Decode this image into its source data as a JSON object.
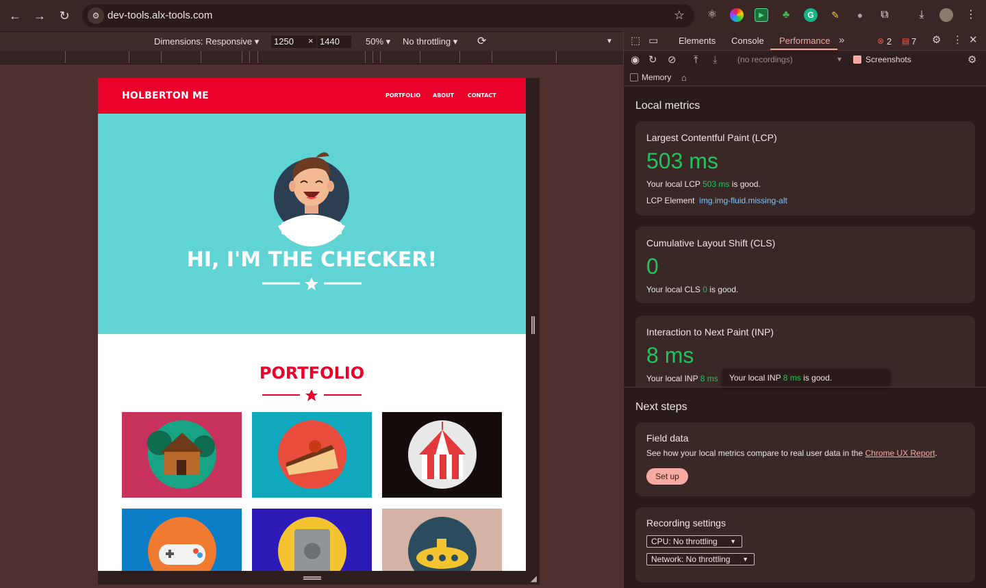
{
  "browser": {
    "url": "dev-tools.alx-tools.com"
  },
  "device_toolbar": {
    "dimensions_label": "Dimensions: Responsive",
    "width": "1250",
    "times": "×",
    "height": "1440",
    "zoom": "50%",
    "throttling": "No throttling"
  },
  "site": {
    "brand": "HOLBERTON ME",
    "nav": [
      "PORTFOLIO",
      "ABOUT",
      "CONTACT"
    ],
    "hero_title": "HI, I'M THE CHECKER!",
    "portfolio_title": "PORTFOLIO",
    "colors": {
      "red": "#ea0029",
      "teal": "#60d3d4"
    },
    "tiles": [
      {
        "name": "cabin",
        "bg": "#c6325b"
      },
      {
        "name": "cake",
        "bg": "#0fa8bd"
      },
      {
        "name": "circus",
        "bg": "#140d0c"
      },
      {
        "name": "game",
        "bg": "#0b7dc6"
      },
      {
        "name": "safe",
        "bg": "#2c1bb8"
      },
      {
        "name": "submarine",
        "bg": "#d4b3a4"
      }
    ]
  },
  "devtools": {
    "tabs": [
      "Elements",
      "Console",
      "Performance"
    ],
    "active_tab": "Performance",
    "error_count": "2",
    "message_count": "7",
    "recordings": "(no recordings)",
    "screenshots_label": "Screenshots",
    "memory_label": "Memory",
    "local_metrics": {
      "heading": "Local metrics",
      "lcp": {
        "title": "Largest Contentful Paint (LCP)",
        "value": "503 ms",
        "pre": "Your local LCP ",
        "val_inline": "503 ms",
        "post": " is good.",
        "element_label": "LCP Element",
        "element_value": "img.img-fluid.missing-alt"
      },
      "cls": {
        "title": "Cumulative Layout Shift (CLS)",
        "value": "0",
        "pre": "Your local CLS ",
        "val_inline": "0",
        "post": " is good."
      },
      "inp": {
        "title": "Interaction to Next Paint (INP)",
        "value": "8 ms",
        "pre": "Your local INP ",
        "val_inline": "8 ms",
        "tooltip_pre": "Your local INP ",
        "tooltip_val": "8 ms",
        "tooltip_post": " is good."
      }
    },
    "next_steps": {
      "heading": "Next steps",
      "field_title": "Field data",
      "field_text": "See how your local metrics compare to real user data in the ",
      "field_link": "Chrome UX Report",
      "field_end": ".",
      "setup": "Set up"
    },
    "recording_settings": {
      "title": "Recording settings",
      "cpu": "CPU: No throttling",
      "network": "Network: No throttling"
    },
    "colors": {
      "good": "#1fc45d",
      "accent": "#f4aaa1"
    }
  }
}
